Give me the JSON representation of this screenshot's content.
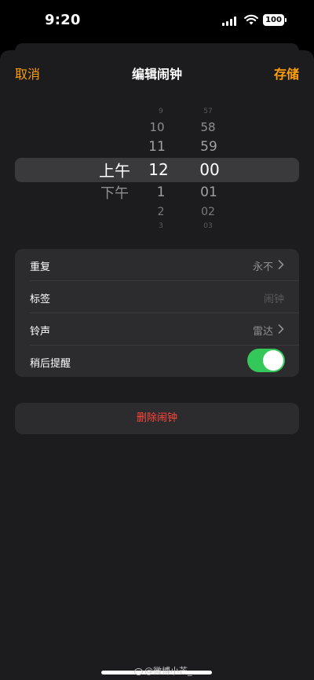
{
  "status_bar": {
    "time": "9:20",
    "battery": "100",
    "icons": [
      "cellular-signal-icon",
      "wifi-icon",
      "battery-icon"
    ]
  },
  "nav": {
    "cancel": "取消",
    "title": "编辑闹钟",
    "save": "存储",
    "accent_color": "#ff9f0a"
  },
  "picker": {
    "period": {
      "options": [
        "上午",
        "下午"
      ],
      "selected": "上午"
    },
    "hour": {
      "visible": [
        "9",
        "10",
        "11",
        "12",
        "1",
        "2",
        "3"
      ],
      "selected": "12"
    },
    "minute": {
      "visible": [
        "57",
        "58",
        "59",
        "00",
        "01",
        "02",
        "03"
      ],
      "selected": "00"
    }
  },
  "settings": {
    "repeat": {
      "label": "重复",
      "value": "永不"
    },
    "label": {
      "label": "标签",
      "placeholder": "闹钟"
    },
    "sound": {
      "label": "铃声",
      "value": "雷达"
    },
    "snooze": {
      "label": "稍后提醒",
      "enabled": true,
      "on_color": "#34c759"
    }
  },
  "delete": {
    "label": "删除闹钟",
    "color": "#ff453a"
  },
  "watermark": {
    "text": "@微博小芒_"
  }
}
